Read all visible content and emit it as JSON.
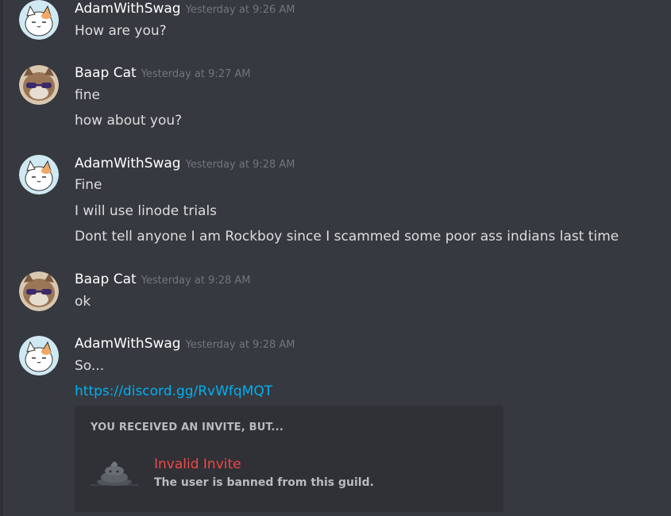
{
  "messages": [
    {
      "author": "AdamWithSwag",
      "timestamp": "Yesterday at 9:26 AM",
      "lines": [
        "How are you?"
      ],
      "avatar": "cat-cartoon-avatar"
    },
    {
      "author": "Baap Cat",
      "timestamp": "Yesterday at 9:27 AM",
      "lines": [
        "fine",
        "how about you?"
      ],
      "avatar": "cat-sunglasses-avatar"
    },
    {
      "author": "AdamWithSwag",
      "timestamp": "Yesterday at 9:28 AM",
      "lines": [
        "Fine",
        "I will use linode trials",
        "Dont tell anyone I am Rockboy since I scammed some poor ass indians last time"
      ],
      "avatar": "cat-cartoon-avatar"
    },
    {
      "author": "Baap Cat",
      "timestamp": "Yesterday at 9:28 AM",
      "lines": [
        "ok"
      ],
      "avatar": "cat-sunglasses-avatar"
    },
    {
      "author": "AdamWithSwag",
      "timestamp": "Yesterday at 9:28 AM",
      "lines": [
        "So..."
      ],
      "link": "https://discord.gg/RvWfqMQT",
      "avatar": "cat-cartoon-avatar"
    }
  ],
  "invite_embed": {
    "header": "YOU RECEIVED AN INVITE, BUT...",
    "title": "Invalid Invite",
    "subtitle": "The user is banned from this guild.",
    "icon": "poop-icon"
  },
  "colors": {
    "background": "#36393f",
    "embed_bg": "#2f3136",
    "author": "#ffffff",
    "timestamp": "#72767d",
    "text": "#dcddde",
    "link": "#00b0f4",
    "invalid": "#f04747"
  }
}
